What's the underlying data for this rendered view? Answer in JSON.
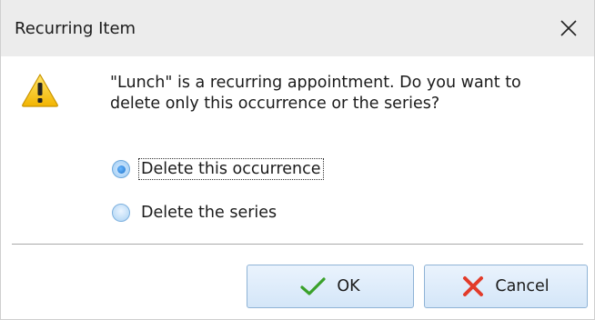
{
  "window": {
    "title": "Recurring Item",
    "close_icon": "close-icon"
  },
  "message": {
    "text": "\"Lunch\" is a recurring appointment. Do you want to delete only this occurrence or the series?",
    "icon": "warning-icon"
  },
  "options": [
    {
      "label": "Delete this occurrence",
      "selected": true
    },
    {
      "label": "Delete the series",
      "selected": false
    }
  ],
  "buttons": {
    "ok": {
      "label": "OK",
      "icon": "checkmark-icon"
    },
    "cancel": {
      "label": "Cancel",
      "icon": "x-icon"
    }
  },
  "colors": {
    "accent": "#1e73c9",
    "titlebar": "#ececec",
    "button_border": "#8fb3d6"
  }
}
